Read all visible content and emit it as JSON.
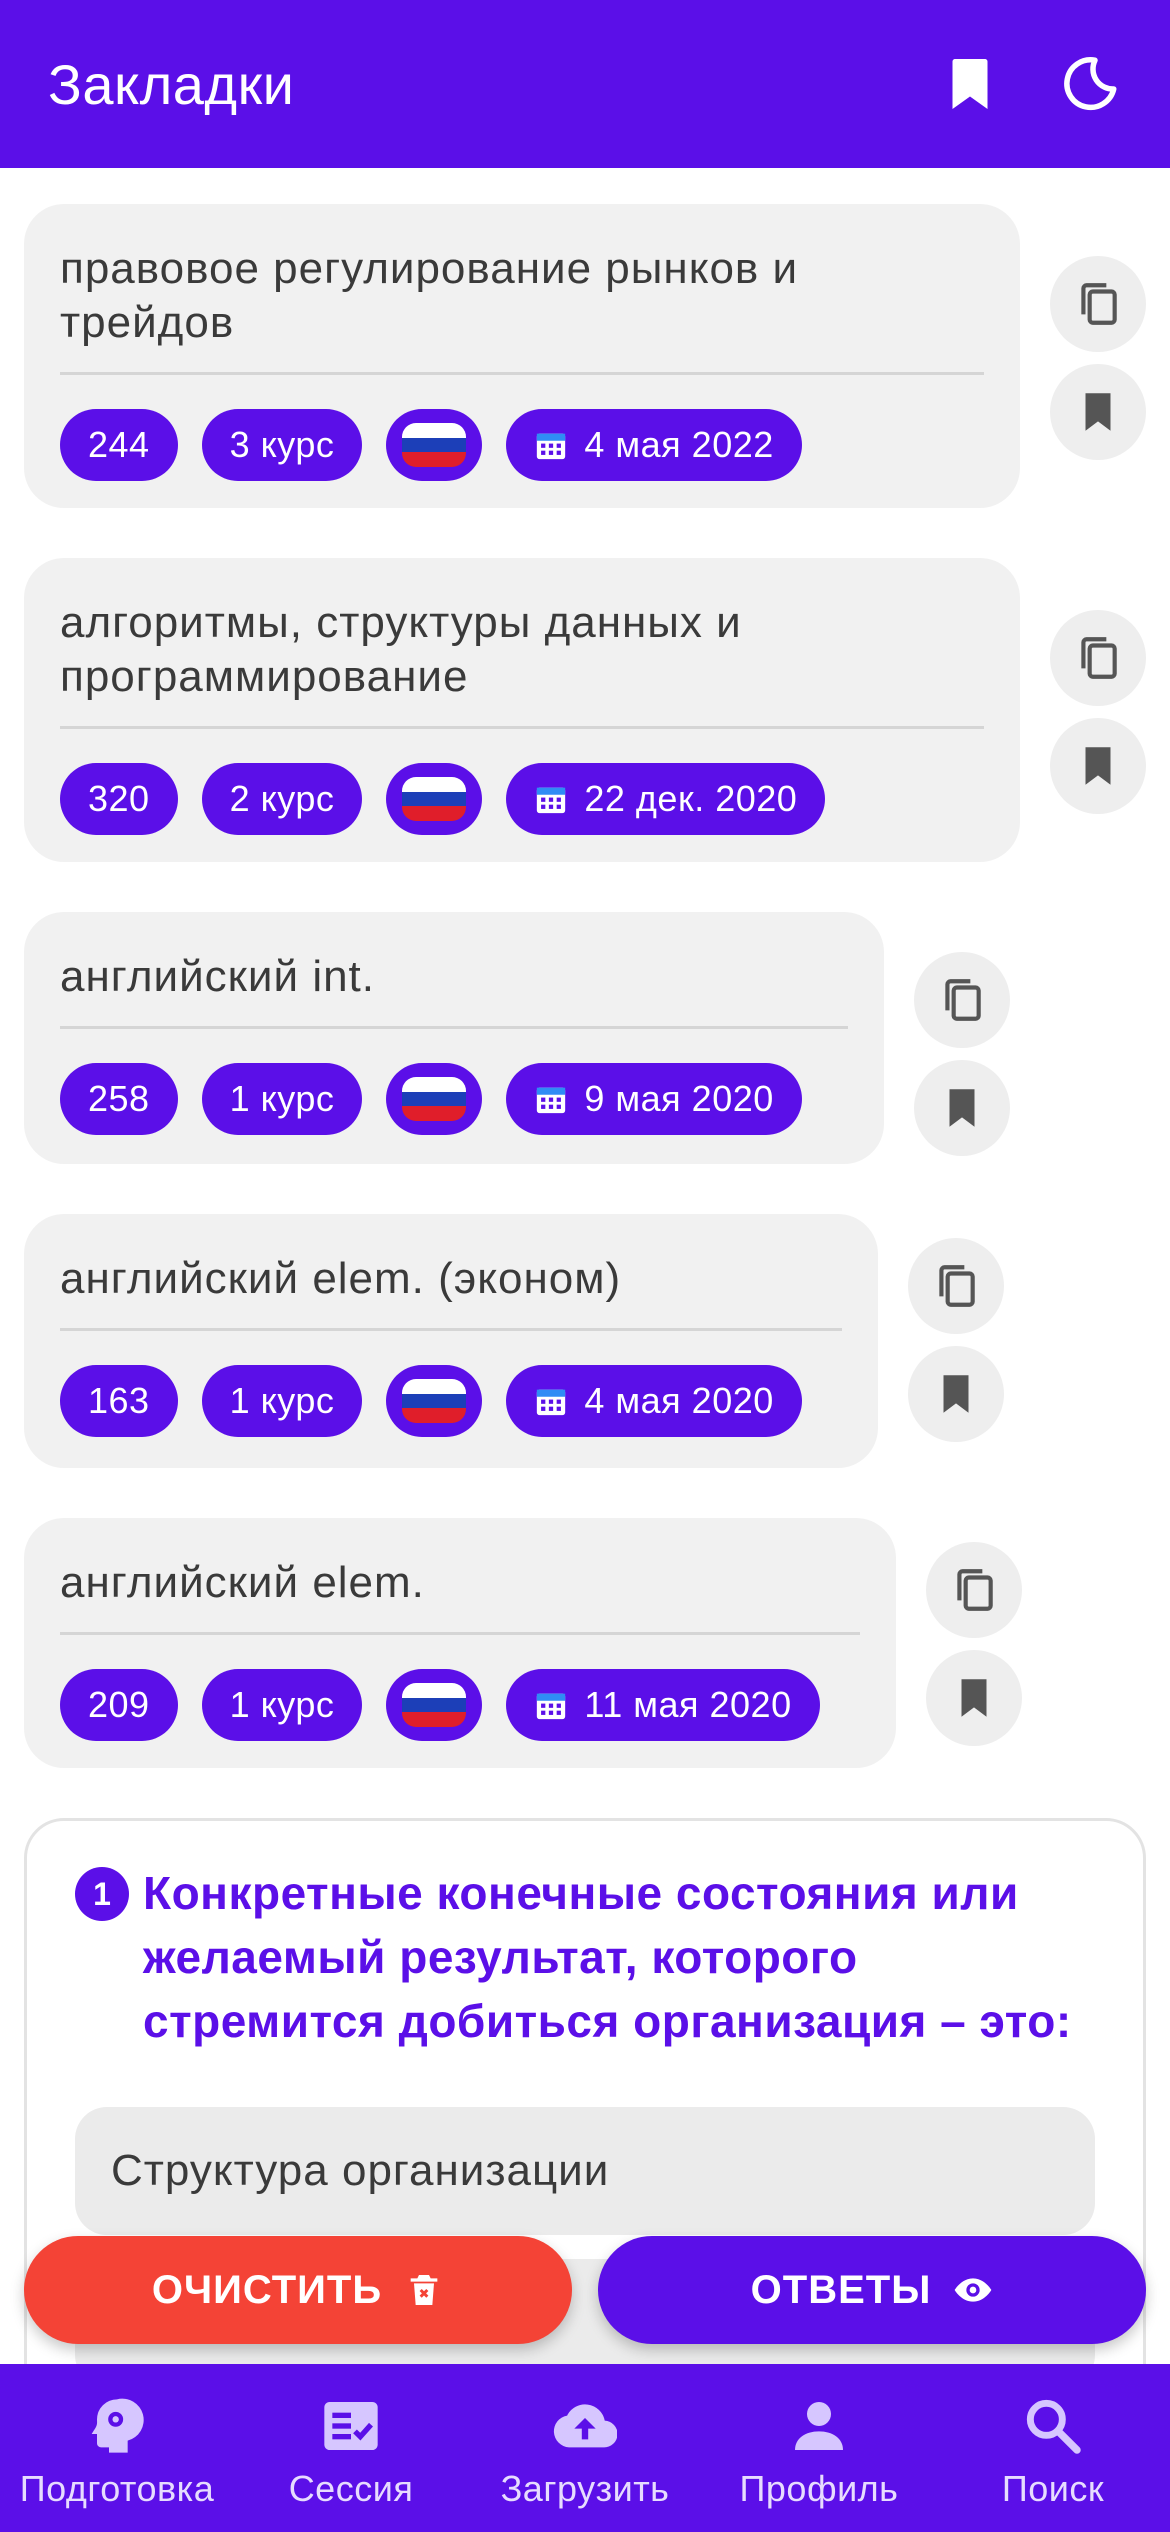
{
  "header": {
    "title": "Закладки",
    "bookmark_icon": "bookmark-icon",
    "theme_icon": "moon-icon"
  },
  "colors": {
    "accent": "#5b0fe8",
    "danger": "#f44336",
    "card_bg": "#f1f1f1"
  },
  "cards": [
    {
      "title": "правовое регулирование рынков и трейдов",
      "count": "244",
      "course": "3 курс",
      "date": "4 мая 2022"
    },
    {
      "title": "алгоритмы, структуры данных и программирование",
      "count": "320",
      "course": "2 курс",
      "date": "22 дек. 2020"
    },
    {
      "title": "английский int.",
      "count": "258",
      "course": "1 курс",
      "date": "9 мая 2020"
    },
    {
      "title": "английский elem. (эконом)",
      "count": "163",
      "course": "1 курс",
      "date": "4 мая 2020"
    },
    {
      "title": "английский elem.",
      "count": "209",
      "course": "1 курс",
      "date": "11 мая 2020"
    }
  ],
  "question": {
    "number": "1",
    "text": "Конкретные конечные состояния или желаемый результат, которого стремится добиться организация – это:",
    "answers": [
      "Структура организации"
    ]
  },
  "actions": {
    "clear_label": "ОЧИСТИТЬ",
    "answers_label": "ОТВЕТЫ"
  },
  "nav": {
    "items": [
      {
        "label": "Подготовка",
        "icon": "brain-icon"
      },
      {
        "label": "Сессия",
        "icon": "checklist-icon"
      },
      {
        "label": "Загрузить",
        "icon": "cloud-upload-icon"
      },
      {
        "label": "Профиль",
        "icon": "person-icon"
      },
      {
        "label": "Поиск",
        "icon": "search-icon"
      }
    ]
  }
}
